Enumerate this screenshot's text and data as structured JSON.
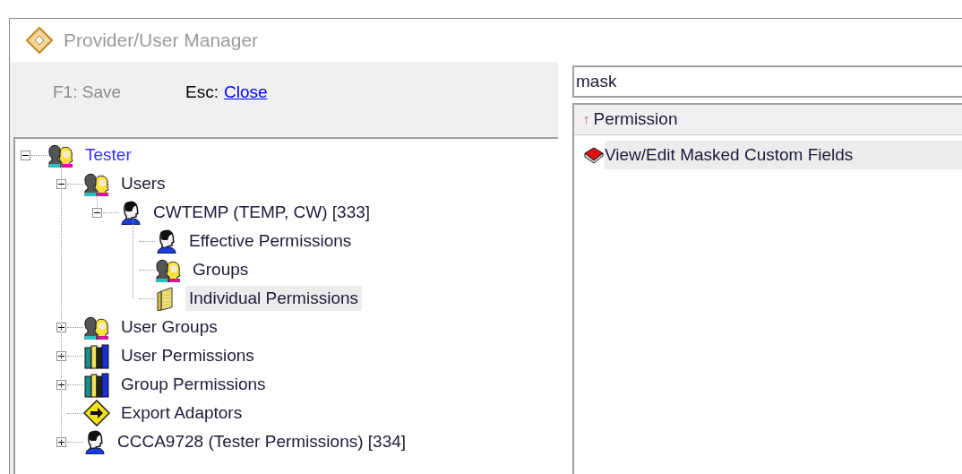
{
  "window": {
    "title": "Provider/User Manager"
  },
  "toolbar": {
    "save": {
      "label": "F1: Save",
      "disabled": true
    },
    "close": {
      "key": "Esc:",
      "link": "Close"
    }
  },
  "tree": [
    {
      "label": "Tester",
      "kind": "people",
      "expanded": true,
      "selected": false,
      "children": [
        {
          "label": "Users",
          "kind": "people",
          "expanded": true,
          "selected": false,
          "children": [
            {
              "label": "CWTEMP (TEMP, CW) [333]",
              "kind": "person",
              "expanded": true,
              "selected": false,
              "children": [
                {
                  "label": "Effective Permissions",
                  "kind": "person",
                  "selected": false
                },
                {
                  "label": "Groups",
                  "kind": "people",
                  "selected": false
                },
                {
                  "label": "Individual Permissions",
                  "kind": "folder",
                  "selected": true
                }
              ]
            }
          ]
        },
        {
          "label": "User Groups",
          "kind": "people",
          "expanded": false,
          "selected": false
        },
        {
          "label": "User Permissions",
          "kind": "books",
          "expanded": false,
          "selected": false
        },
        {
          "label": "Group Permissions",
          "kind": "books",
          "expanded": false,
          "selected": false
        },
        {
          "label": "Export Adaptors",
          "kind": "sign",
          "selected": false
        },
        {
          "label": "CCCA9728 (Tester Permissions) [334]",
          "kind": "person",
          "expanded": false,
          "selected": false
        }
      ]
    }
  ],
  "search": {
    "value": "mask"
  },
  "list": {
    "column": {
      "sort_indicator": "↑",
      "label": "Permission"
    },
    "rows": [
      {
        "label": "View/Edit Masked Custom Fields",
        "selected": true
      }
    ]
  }
}
